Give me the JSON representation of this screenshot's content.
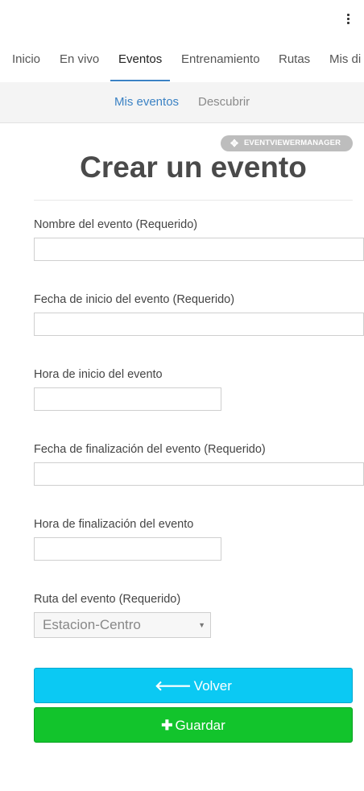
{
  "topbar": {
    "menu_icon": "more-vertical-icon"
  },
  "nav": {
    "tabs": [
      {
        "label": "Inicio"
      },
      {
        "label": "En vivo"
      },
      {
        "label": "Eventos",
        "active": true
      },
      {
        "label": "Entrenamiento"
      },
      {
        "label": "Rutas"
      },
      {
        "label": "Mis di"
      }
    ]
  },
  "subnav": {
    "tabs": [
      {
        "label": "Mis eventos",
        "active": true
      },
      {
        "label": "Descubrir"
      }
    ]
  },
  "badge": {
    "icon": "move-icon",
    "label": "EVENTVIEWERMANAGER"
  },
  "page": {
    "title": "Crear un evento"
  },
  "form": {
    "event_name_label": "Nombre del evento (Requerido)",
    "event_name_value": "",
    "start_date_label": "Fecha de inicio del evento (Requerido)",
    "start_date_value": "",
    "start_time_label": "Hora de inicio del evento",
    "start_time_value": "",
    "end_date_label": "Fecha de finalización del evento (Requerido)",
    "end_date_value": "",
    "end_time_label": "Hora de finalización del evento",
    "end_time_value": "",
    "route_label": "Ruta del evento (Requerido)",
    "route_value": "Estacion-Centro"
  },
  "actions": {
    "back_icon": "arrow-left-icon",
    "back_label": "Volver",
    "save_icon": "plus-icon",
    "save_label": "Guardar"
  },
  "colors": {
    "accent": "#3b82c4",
    "back_button": "#0bc9f3",
    "save_button": "#12c42c"
  }
}
